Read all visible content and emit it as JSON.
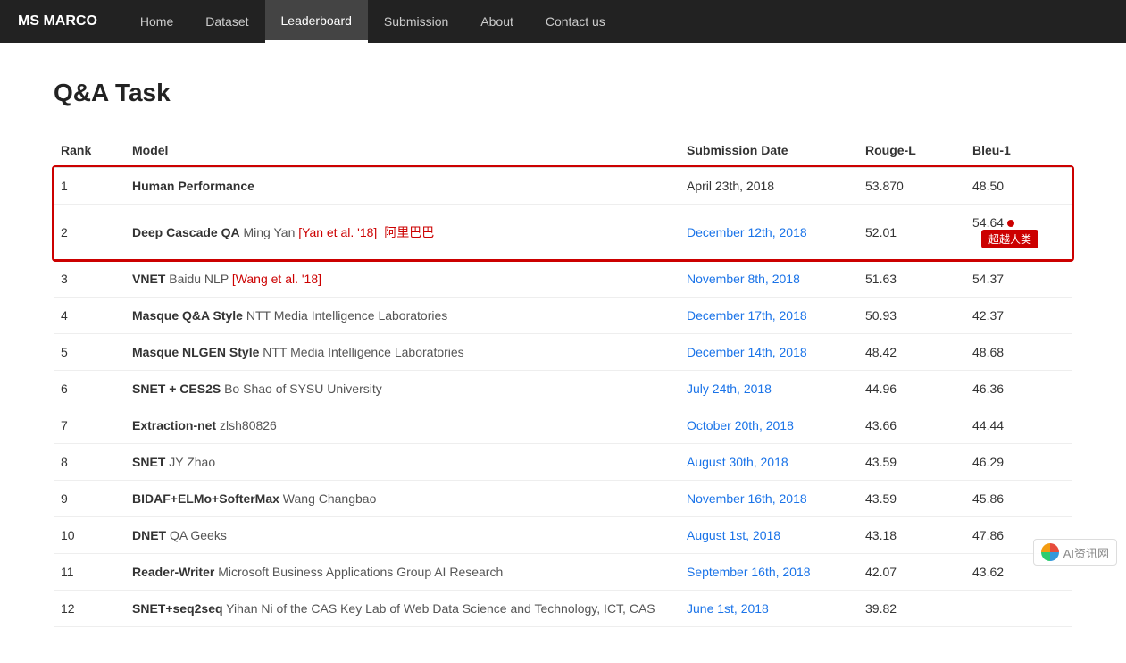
{
  "brand": "MS MARCO",
  "nav": {
    "items": [
      {
        "label": "Home",
        "active": false
      },
      {
        "label": "Dataset",
        "active": false
      },
      {
        "label": "Leaderboard",
        "active": true
      },
      {
        "label": "Submission",
        "active": false
      },
      {
        "label": "About",
        "active": false
      },
      {
        "label": "Contact us",
        "active": false
      }
    ]
  },
  "page": {
    "title": "Q&A Task"
  },
  "table": {
    "headers": [
      "Rank",
      "Model",
      "Submission Date",
      "Rouge-L",
      "Bleu-1"
    ],
    "rows": [
      {
        "rank": "1",
        "model_bold": "Human Performance",
        "model_normal": "",
        "model_link": "",
        "model_link2": "",
        "date": "April 23th, 2018",
        "date_linked": false,
        "rouge": "53.870",
        "bleu": "48.50",
        "highlight": true,
        "badge": "",
        "dot": false
      },
      {
        "rank": "2",
        "model_bold": "Deep Cascade QA",
        "model_normal": "Ming Yan ",
        "model_link": "[Yan et al. '18]",
        "model_link2": "阿里巴巴",
        "date": "December 12th, 2018",
        "date_linked": true,
        "rouge": "52.01",
        "bleu": "54.64",
        "highlight": true,
        "badge": "超越人类",
        "dot": true
      },
      {
        "rank": "3",
        "model_bold": "VNET",
        "model_normal": "Baidu NLP ",
        "model_link": "[Wang et al. '18]",
        "model_link2": "",
        "date": "November 8th, 2018",
        "date_linked": true,
        "rouge": "51.63",
        "bleu": "54.37",
        "highlight": false,
        "badge": "",
        "dot": false
      },
      {
        "rank": "4",
        "model_bold": "Masque Q&A Style",
        "model_normal": "NTT Media Intelligence Laboratories",
        "model_link": "",
        "model_link2": "",
        "date": "December 17th, 2018",
        "date_linked": true,
        "rouge": "50.93",
        "bleu": "42.37",
        "highlight": false,
        "badge": "",
        "dot": false
      },
      {
        "rank": "5",
        "model_bold": "Masque NLGEN Style",
        "model_normal": "NTT Media Intelligence Laboratories",
        "model_link": "",
        "model_link2": "",
        "date": "December 14th, 2018",
        "date_linked": true,
        "rouge": "48.42",
        "bleu": "48.68",
        "highlight": false,
        "badge": "",
        "dot": false
      },
      {
        "rank": "6",
        "model_bold": "SNET + CES2S",
        "model_normal": "Bo Shao of SYSU University",
        "model_link": "",
        "model_link2": "",
        "date": "July 24th, 2018",
        "date_linked": true,
        "rouge": "44.96",
        "bleu": "46.36",
        "highlight": false,
        "badge": "",
        "dot": false
      },
      {
        "rank": "7",
        "model_bold": "Extraction-net",
        "model_normal": "zlsh80826",
        "model_link": "",
        "model_link2": "",
        "date": "October 20th, 2018",
        "date_linked": true,
        "rouge": "43.66",
        "bleu": "44.44",
        "highlight": false,
        "badge": "",
        "dot": false
      },
      {
        "rank": "8",
        "model_bold": "SNET",
        "model_normal": "JY Zhao",
        "model_link": "",
        "model_link2": "",
        "date": "August 30th, 2018",
        "date_linked": true,
        "rouge": "43.59",
        "bleu": "46.29",
        "highlight": false,
        "badge": "",
        "dot": false
      },
      {
        "rank": "9",
        "model_bold": "BIDAF+ELMo+SofterMax",
        "model_normal": "Wang Changbao",
        "model_link": "",
        "model_link2": "",
        "date": "November 16th, 2018",
        "date_linked": true,
        "rouge": "43.59",
        "bleu": "45.86",
        "highlight": false,
        "badge": "",
        "dot": false
      },
      {
        "rank": "10",
        "model_bold": "DNET",
        "model_normal": "QA Geeks",
        "model_link": "",
        "model_link2": "",
        "date": "August 1st, 2018",
        "date_linked": true,
        "rouge": "43.18",
        "bleu": "47.86",
        "highlight": false,
        "badge": "",
        "dot": false
      },
      {
        "rank": "11",
        "model_bold": "Reader-Writer",
        "model_normal": "Microsoft Business Applications Group AI Research",
        "model_link": "",
        "model_link2": "",
        "date": "September 16th, 2018",
        "date_linked": true,
        "rouge": "42.07",
        "bleu": "43.62",
        "highlight": false,
        "badge": "",
        "dot": false
      },
      {
        "rank": "12",
        "model_bold": "SNET+seq2seq",
        "model_normal": "Yihan Ni of the CAS Key Lab of Web Data Science and Technology, ICT, CAS",
        "model_link": "",
        "model_link2": "",
        "date": "June 1st, 2018",
        "date_linked": true,
        "rouge": "39.82",
        "bleu": "",
        "highlight": false,
        "badge": "",
        "dot": false
      }
    ]
  }
}
